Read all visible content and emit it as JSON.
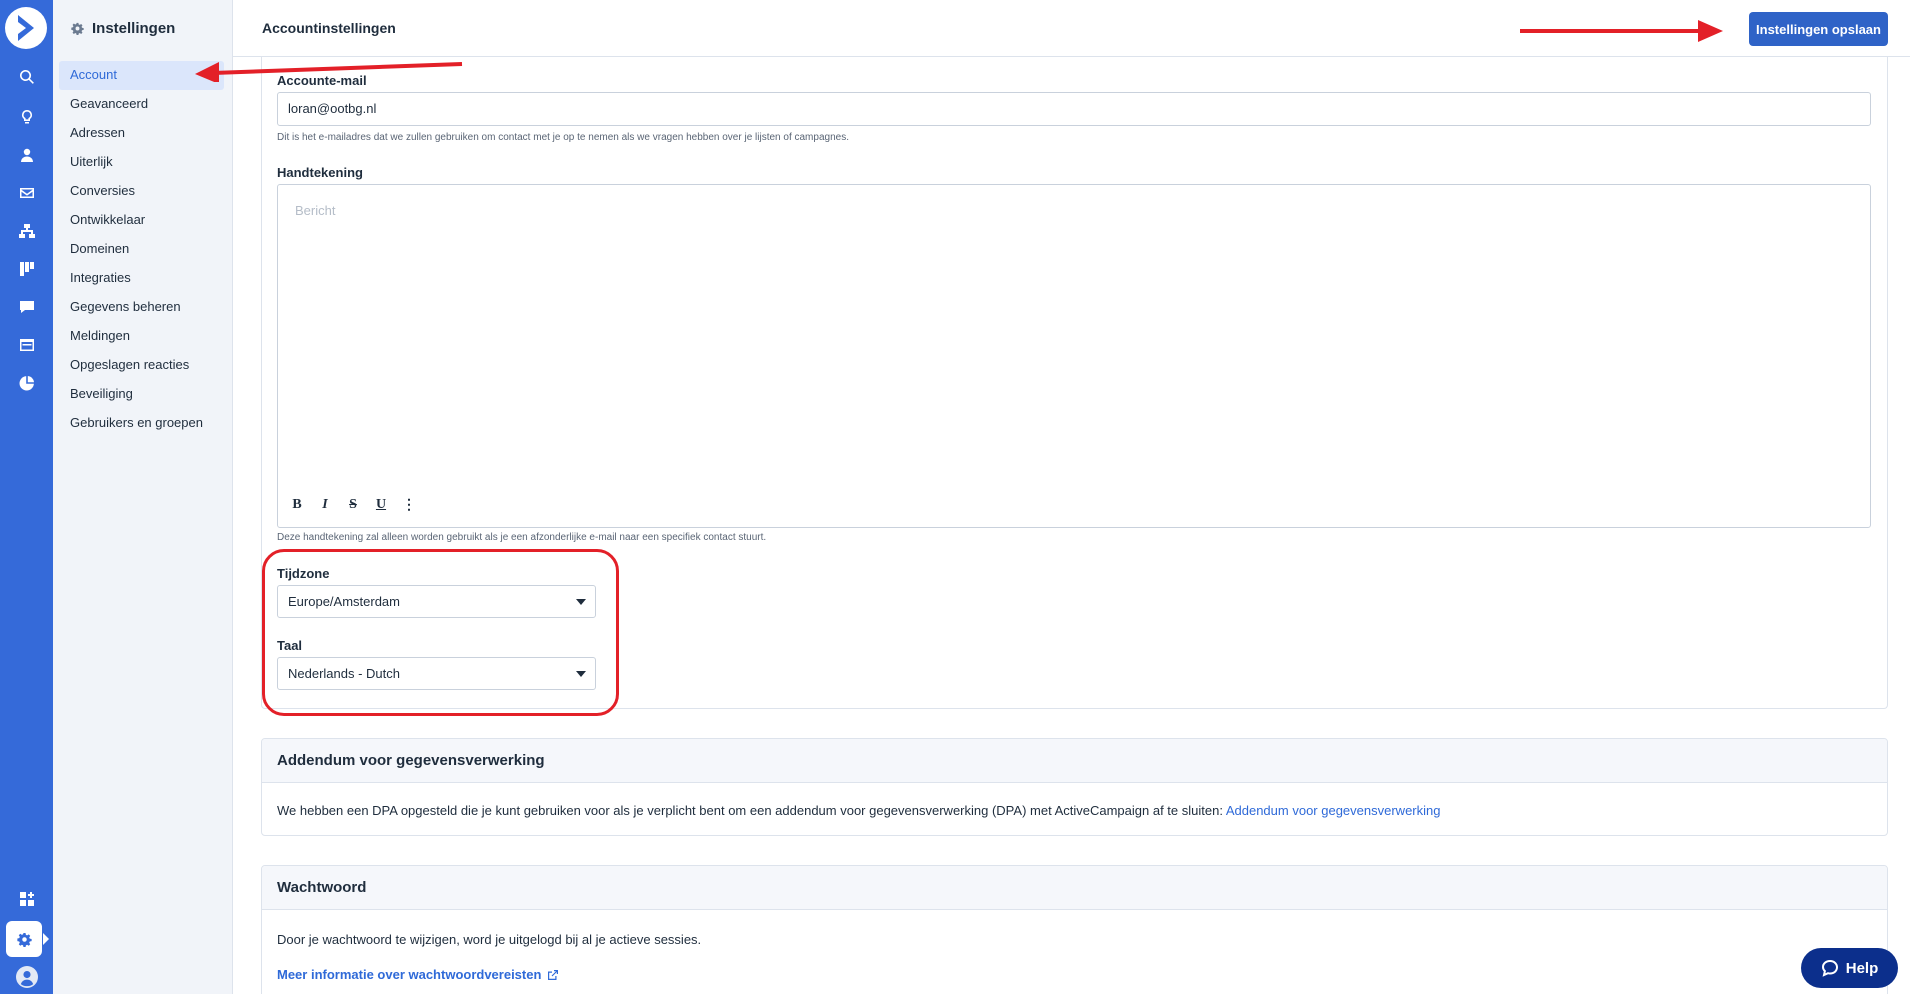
{
  "header": {
    "title": "Accountinstellingen",
    "save_label": "Instellingen opslaan"
  },
  "sidebar": {
    "title": "Instellingen",
    "items": [
      {
        "label": "Account",
        "active": true
      },
      {
        "label": "Geavanceerd"
      },
      {
        "label": "Adressen"
      },
      {
        "label": "Uiterlijk"
      },
      {
        "label": "Conversies"
      },
      {
        "label": "Ontwikkelaar"
      },
      {
        "label": "Domeinen"
      },
      {
        "label": "Integraties"
      },
      {
        "label": "Gegevens beheren"
      },
      {
        "label": "Meldingen"
      },
      {
        "label": "Opgeslagen reacties"
      },
      {
        "label": "Beveiliging"
      },
      {
        "label": "Gebruikers en groepen"
      }
    ]
  },
  "rail": {
    "icons": [
      "logo-icon",
      "search-icon",
      "lightbulb-icon",
      "contacts-icon",
      "email-icon",
      "automations-icon",
      "pipeline-icon",
      "conversations-icon",
      "site-icon",
      "reports-icon",
      "apps-icon",
      "settings-icon",
      "profile-icon"
    ]
  },
  "account": {
    "email_label": "Accounte-mail",
    "email_value": "loran@ootbg.nl",
    "email_help": "Dit is het e-mailadres dat we zullen gebruiken om contact met je op te nemen als we vragen hebben over je lijsten of campagnes.",
    "signature_label": "Handtekening",
    "signature_placeholder": "Bericht",
    "signature_help": "Deze handtekening zal alleen worden gebruikt als je een afzonderlijke e-mail naar een specifiek contact stuurt.",
    "timezone_label": "Tijdzone",
    "timezone_value": "Europe/Amsterdam",
    "language_label": "Taal",
    "language_value": "Nederlands - Dutch"
  },
  "toolbar": {
    "bold": "B",
    "italic": "I",
    "strike": "S",
    "underline": "U",
    "more": "⋮"
  },
  "dpa": {
    "title": "Addendum voor gegevensverwerking",
    "text": "We hebben een DPA opgesteld die je kunt gebruiken voor als je verplicht bent om een addendum voor gegevensverwerking (DPA) met ActiveCampaign af te sluiten: ",
    "link": "Addendum voor gegevensverwerking"
  },
  "password": {
    "title": "Wachtwoord",
    "text": "Door je wachtwoord te wijzigen, word je uitgelogd bij al je actieve sessies.",
    "link": "Meer informatie over wachtwoordvereisten"
  },
  "help_button": "Help",
  "colors": {
    "rail": "#356ad9",
    "accent": "#2f63c7",
    "annotation": "#e32028",
    "help": "#0c2f8c"
  }
}
